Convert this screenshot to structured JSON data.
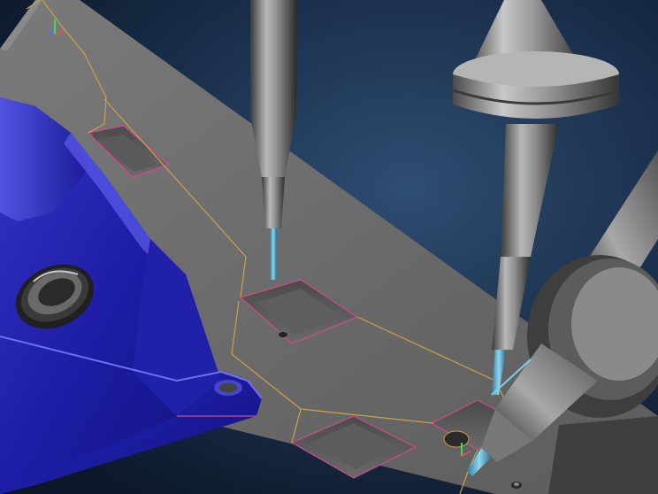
{
  "scene": {
    "subject": "cam-5-axis-milling-simulation",
    "colors": {
      "background_center": "#2c4a6e",
      "background_edge": "#0f1d30",
      "plate_top": "#6e6e6e",
      "plate_side": "#3d3d3d",
      "workpiece": "#1c1c9a",
      "workpiece_highlight": "#4a4ad8",
      "toolpath": "#c9a24a",
      "pocket_edge": "#d04a8a",
      "tool_steel": "#8a8a8a",
      "tool_tip": "#4aa8c8"
    },
    "icons": [
      "milling-tool",
      "workpiece-part",
      "fixture-plate",
      "toolpath-line",
      "axis-triad"
    ]
  }
}
